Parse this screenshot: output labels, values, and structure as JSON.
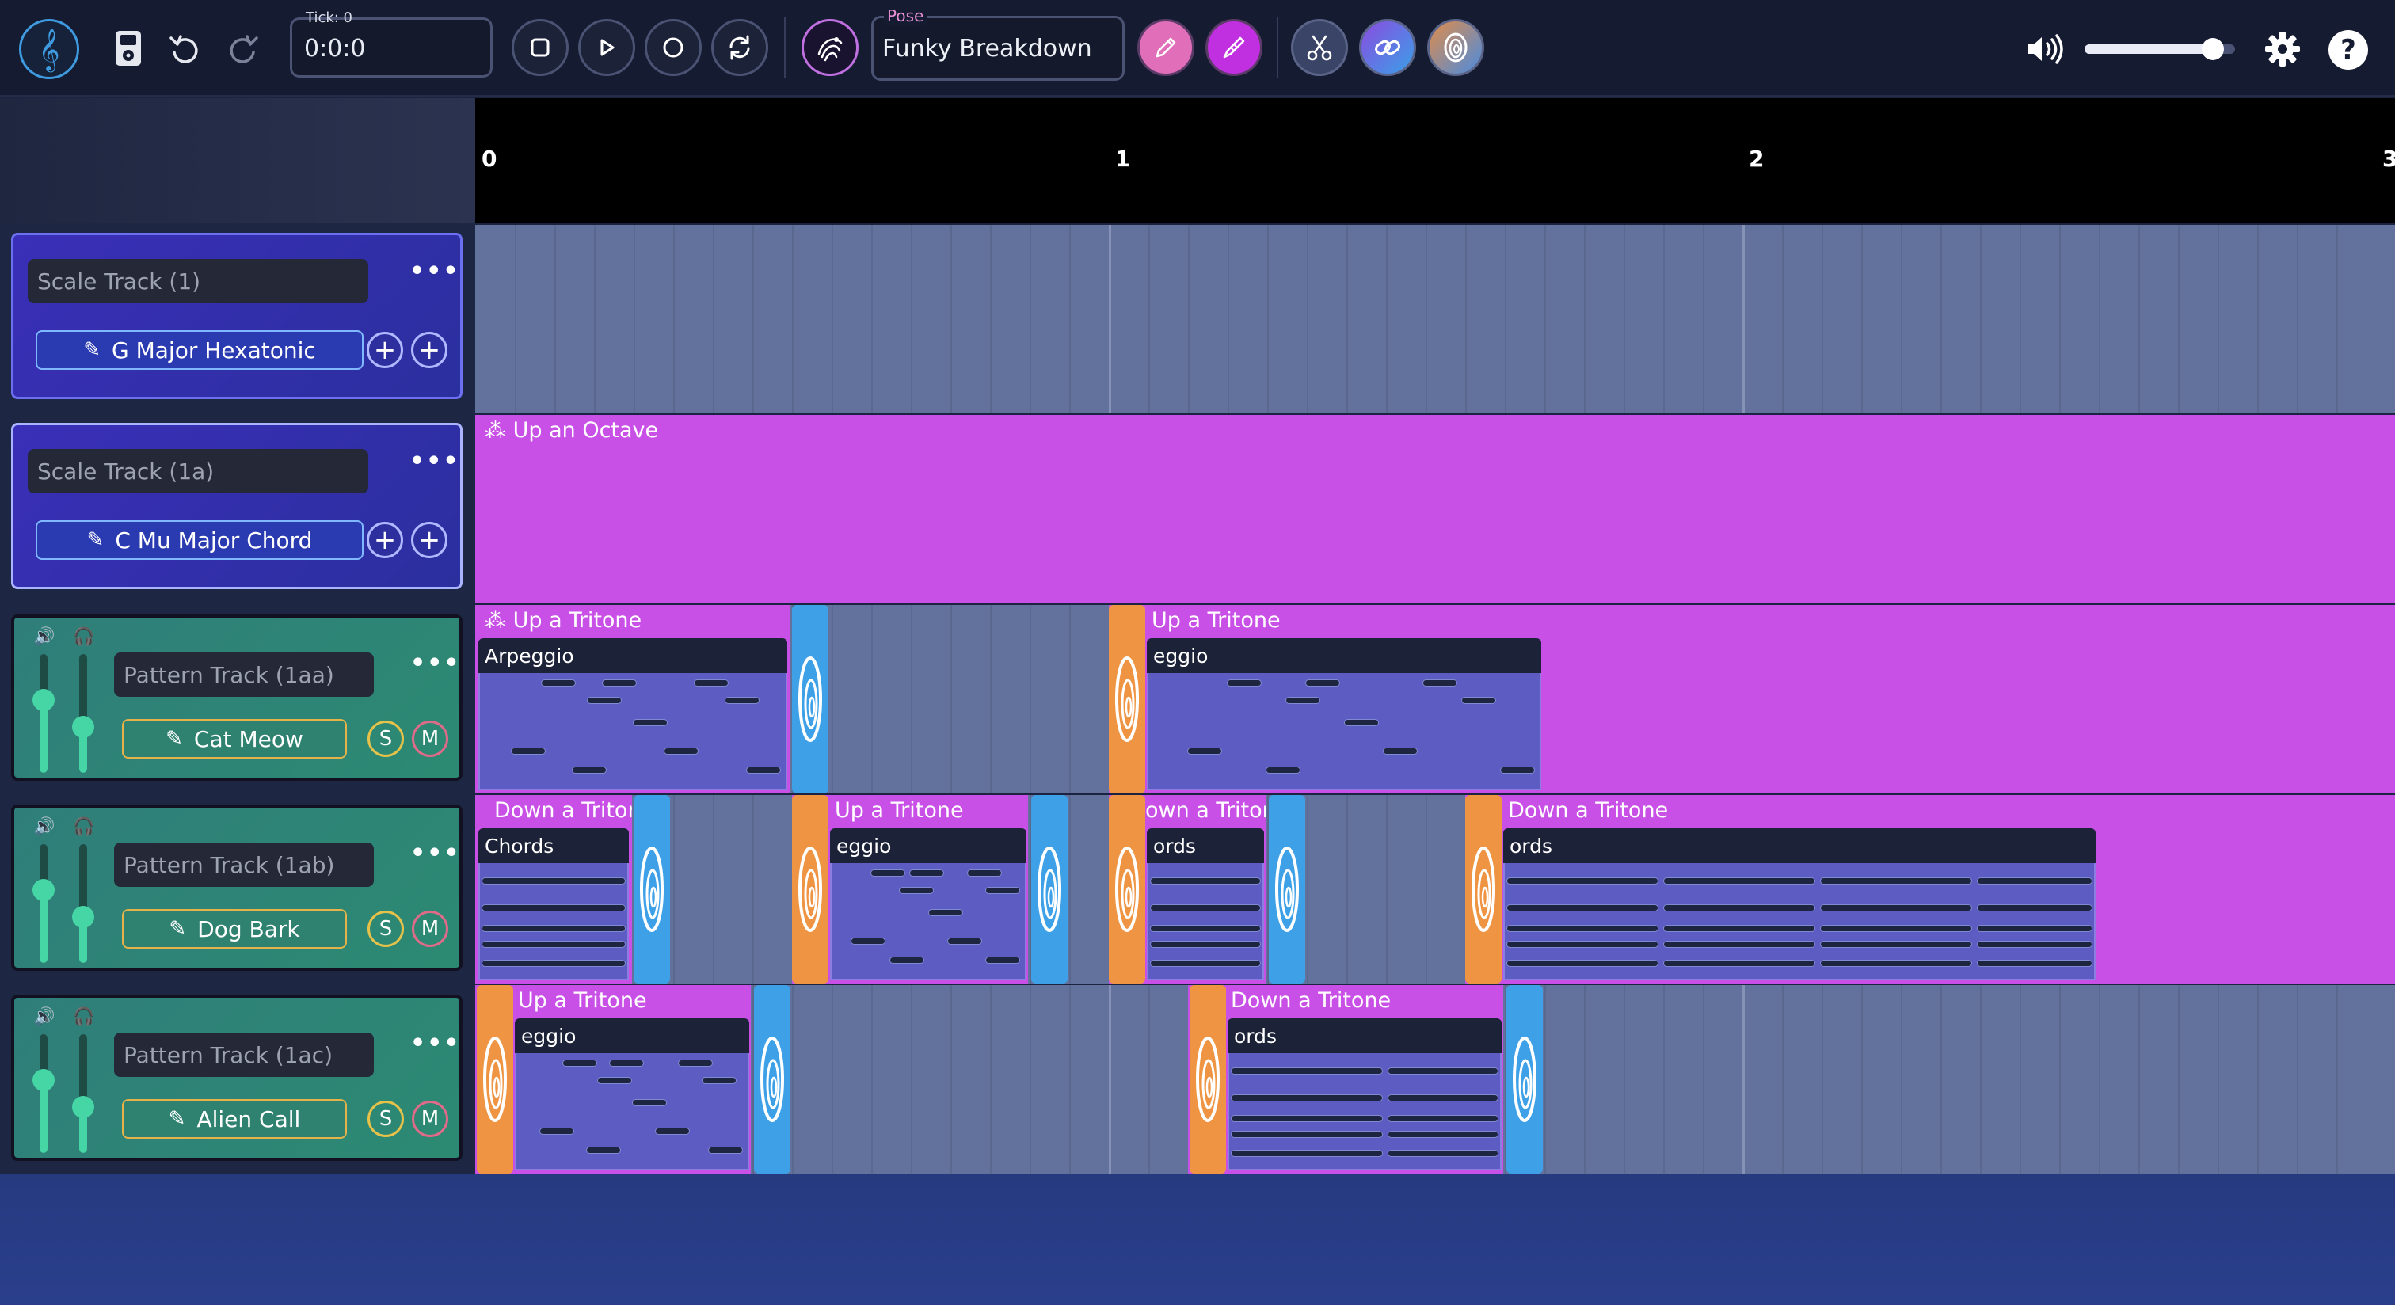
{
  "toolbar": {
    "tick_label": "Tick: 0",
    "tick_value": "0:0:0",
    "pose_label": "Pose",
    "pose_value": "Funky Breakdown",
    "icons": [
      "treble-clef-icon",
      "ipod-icon",
      "undo-icon",
      "redo-icon",
      "stop-icon",
      "play-icon",
      "record-icon",
      "loop-icon",
      "pose-logo-icon",
      "pencil-icon",
      "brush-icon",
      "scissors-icon",
      "link-icon",
      "portal-icon",
      "volume-icon",
      "settings-icon",
      "help-icon"
    ],
    "volume_level": 0.85
  },
  "ruler": {
    "marks": [
      "0",
      "1",
      "2",
      "3"
    ]
  },
  "tracks": [
    {
      "kind": "scale",
      "name": "Scale Track (1)",
      "instrument": "G Major Hexatonic"
    },
    {
      "kind": "scale",
      "name": "Scale Track (1a)",
      "instrument": "C Mu Major Chord"
    },
    {
      "kind": "pattern",
      "name": "Pattern Track (1aa)",
      "instrument": "Cat Meow",
      "solo": "S",
      "mute": "M"
    },
    {
      "kind": "pattern",
      "name": "Pattern Track (1ab)",
      "instrument": "Dog Bark",
      "solo": "S",
      "mute": "M"
    },
    {
      "kind": "pattern",
      "name": "Pattern Track (1ac)",
      "instrument": "Alien Call",
      "solo": "S",
      "mute": "M"
    }
  ],
  "clips": {
    "lane2_title": "Up an Octave",
    "lane3": [
      {
        "title": "Up a Tritone",
        "head": "Arpeggio"
      },
      {
        "title": "Up a Tritone",
        "head": "eggio"
      }
    ],
    "lane4": [
      {
        "title": "Down a Triton",
        "head": "Chords"
      },
      {
        "title": "Up a Tritone",
        "head": "eggio"
      },
      {
        "title": "own a Triton",
        "head": "ords"
      },
      {
        "title": "Down a Tritone",
        "head": "ords"
      }
    ],
    "lane5": [
      {
        "title": "Up a Tritone",
        "head": "eggio"
      },
      {
        "title": "Down a Tritone",
        "head": "ords"
      }
    ]
  },
  "colors": {
    "magenta": "#c950e6",
    "lane": "#62729c",
    "port_blue": "#3ea1e8",
    "port_orange": "#ef9442"
  }
}
